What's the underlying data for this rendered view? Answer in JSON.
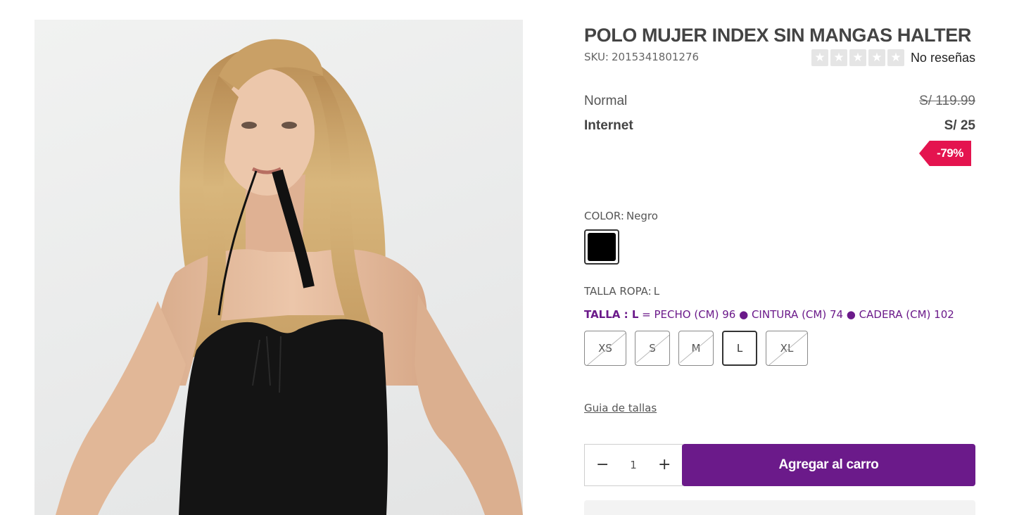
{
  "product": {
    "title": "POLO MUJER INDEX SIN MANGAS HALTER",
    "sku_label": "SKU:",
    "sku_value": "2015341801276",
    "image_alt": "Mujer con polo negro sin mangas halter"
  },
  "rating": {
    "stars_filled": 0,
    "stars_total": 5,
    "reviews_text": "No reseñas"
  },
  "prices": {
    "normal_label": "Normal",
    "normal_value": "S/ 119.99",
    "internet_label": "Internet",
    "internet_value": "S/ 25",
    "discount_badge": "-79%"
  },
  "color": {
    "label": "COLOR:",
    "selected": "Negro",
    "swatch_hex": "#000000"
  },
  "size": {
    "label": "TALLA ROPA:",
    "selected": "L",
    "measure_prefix": "TALLA : L",
    "measure_text": " = PECHO (CM) 96 ● CINTURA (CM) 74 ● CADERA (CM) 102",
    "options": [
      "XS",
      "S",
      "M",
      "L",
      "XL"
    ],
    "guide_link": "Guia de tallas"
  },
  "cart": {
    "minus": "−",
    "quantity": "1",
    "plus": "+",
    "add_label": "Agregar al carro"
  },
  "colors": {
    "brand_purple": "#6b1a8a",
    "discount_red": "#e4144f"
  }
}
